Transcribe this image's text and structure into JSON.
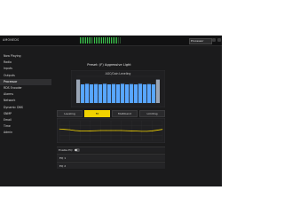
{
  "app": {
    "brand": "AMONEDS",
    "preset_label": "Processor",
    "colors": {
      "background": "#1b1b1c",
      "accent": "#f1d200",
      "meter_green": "#39c24a",
      "bar_blue": "#58a6ff"
    }
  },
  "sidebar": {
    "items": [
      {
        "label": "Now Playing"
      },
      {
        "label": "Radio"
      },
      {
        "label": "Inputs"
      },
      {
        "label": "Outputs"
      },
      {
        "label": "Processor"
      },
      {
        "label": "RDS Encoder"
      },
      {
        "label": "Alarms"
      },
      {
        "label": "Network"
      },
      {
        "label": "Dynamic DNS"
      },
      {
        "label": "SNMP"
      },
      {
        "label": "Email"
      },
      {
        "label": "Time"
      },
      {
        "label": "Admin"
      }
    ]
  },
  "main": {
    "section_title": "Preset: (F) Aggressive Light",
    "tabs": [
      {
        "label": "Leveling"
      },
      {
        "label": "Fit"
      },
      {
        "label": "Multiband"
      },
      {
        "label": "Limiting"
      }
    ],
    "enable_label": "Enable EQ",
    "collapses": [
      {
        "label": "EQ 1"
      },
      {
        "label": "EQ 2"
      }
    ]
  },
  "chart_data": [
    {
      "type": "bar",
      "title": "AGC/Gain Leveling",
      "categories": [
        "1",
        "2",
        "3",
        "4",
        "5",
        "6",
        "7",
        "8",
        "9",
        "10",
        "11",
        "12",
        "13",
        "14",
        "15",
        "16",
        "17",
        "18",
        "19"
      ],
      "values": [
        0.88,
        0.7,
        0.72,
        0.7,
        0.71,
        0.7,
        0.72,
        0.7,
        0.71,
        0.7,
        0.72,
        0.7,
        0.71,
        0.7,
        0.72,
        0.7,
        0.71,
        0.7,
        0.88
      ],
      "ylim": [
        0,
        1
      ]
    },
    {
      "type": "line",
      "title": "",
      "x": [
        0,
        1,
        2,
        3,
        4,
        5,
        6,
        7,
        8,
        9,
        10,
        11,
        12,
        13,
        14,
        15,
        16,
        17,
        18,
        19,
        20
      ],
      "y": [
        0.58,
        0.56,
        0.54,
        0.5,
        0.48,
        0.47,
        0.48,
        0.49,
        0.5,
        0.5,
        0.5,
        0.5,
        0.5,
        0.49,
        0.48,
        0.47,
        0.46,
        0.46,
        0.48,
        0.52,
        0.56
      ],
      "ylim": [
        0,
        1
      ]
    }
  ]
}
